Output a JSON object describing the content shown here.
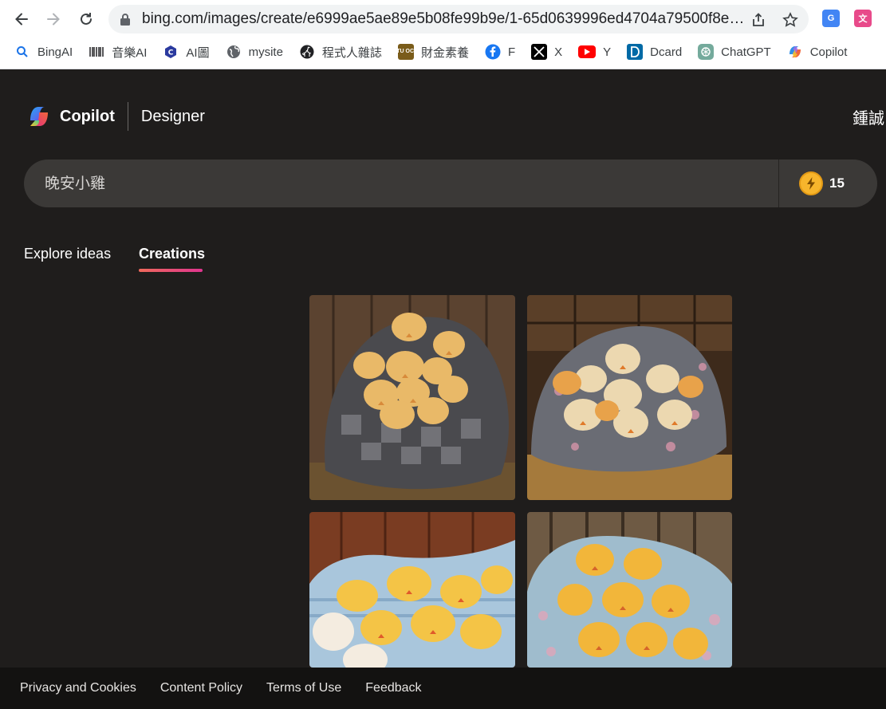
{
  "browser": {
    "url": "bing.com/images/create/e6999ae5ae89e5b08fe99b9e/1-65d0639996ed4704a79500f8ed...",
    "bookmarks": [
      {
        "label": "BingAI",
        "icon": "search-icon"
      },
      {
        "label": "音樂AI",
        "icon": "barcode-icon"
      },
      {
        "label": "AI圖",
        "icon": "cube-icon"
      },
      {
        "label": "mysite",
        "icon": "globe-icon"
      },
      {
        "label": "程式人雜誌",
        "icon": "github-icon"
      },
      {
        "label": "財金素養",
        "icon": "ntu-ocw-icon"
      },
      {
        "label": "F",
        "icon": "facebook-icon"
      },
      {
        "label": "X",
        "icon": "x-icon"
      },
      {
        "label": "Y",
        "icon": "youtube-icon"
      },
      {
        "label": "Dcard",
        "icon": "dcard-icon"
      },
      {
        "label": "ChatGPT",
        "icon": "chatgpt-icon"
      },
      {
        "label": "Copilot",
        "icon": "copilot-icon"
      }
    ],
    "ntu_badge": "NTU OCW"
  },
  "header": {
    "brand": "Copilot",
    "product": "Designer",
    "user": "鍾誠"
  },
  "prompt": {
    "value": "晚安小雞",
    "boosts": "15"
  },
  "tabs": [
    {
      "label": "Explore ideas",
      "active": false
    },
    {
      "label": "Creations",
      "active": true
    }
  ],
  "images": [
    {
      "name": "chicks-checkered-blanket"
    },
    {
      "name": "chicks-floral-grey-blanket"
    },
    {
      "name": "chicks-blue-blanket-red-barn"
    },
    {
      "name": "chicks-blue-floral-blanket-wood"
    }
  ],
  "footer": {
    "links": [
      "Privacy and Cookies",
      "Content Policy",
      "Terms of Use",
      "Feedback"
    ]
  },
  "colors": {
    "page_bg": "#1f1d1c",
    "prompt_bg": "#3b3937",
    "tab_accent_start": "#f0695b",
    "tab_accent_end": "#e0358f",
    "boost": "#f7b52c"
  }
}
